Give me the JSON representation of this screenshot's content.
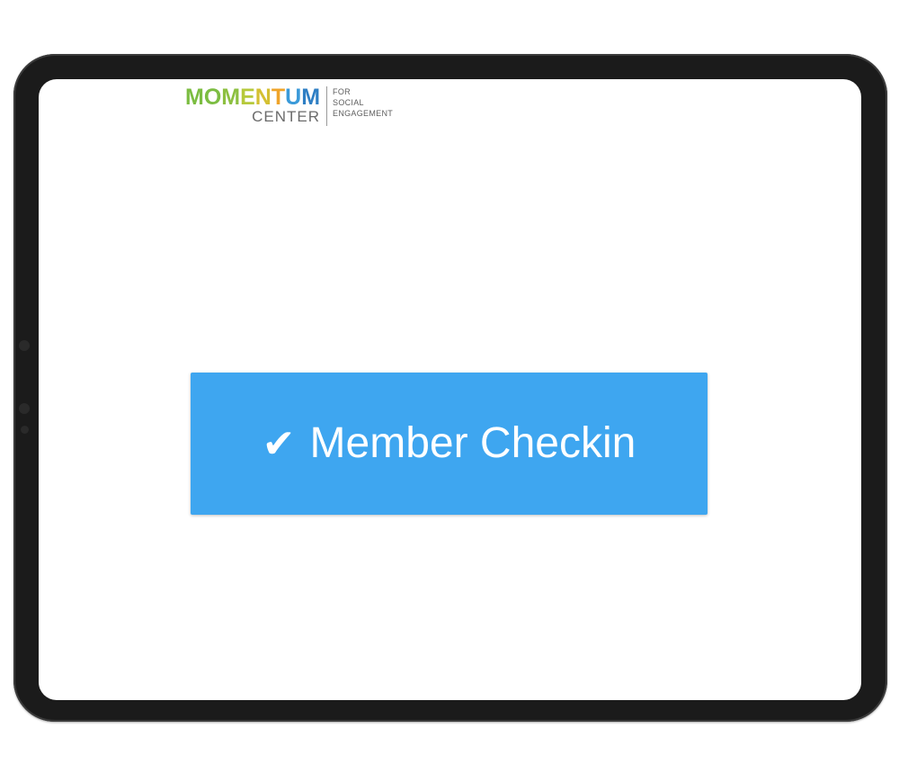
{
  "logo": {
    "letters": [
      {
        "ch": "M",
        "color": "#7cbd42"
      },
      {
        "ch": "O",
        "color": "#7cbd42"
      },
      {
        "ch": "M",
        "color": "#8dc041"
      },
      {
        "ch": "E",
        "color": "#b6c93b"
      },
      {
        "ch": "N",
        "color": "#d4c032"
      },
      {
        "ch": "T",
        "color": "#efa42a"
      },
      {
        "ch": "U",
        "color": "#3a9ad9"
      },
      {
        "ch": "M",
        "color": "#2f7fc4"
      }
    ],
    "subtitle": "CENTER",
    "tagline_line1": "FOR",
    "tagline_line2": "SOCIAL",
    "tagline_line3": "ENGAGEMENT"
  },
  "checkin": {
    "icon": "checkmark-icon",
    "glyph": "✔",
    "label": "Member Checkin",
    "color": "#3ea6f0"
  }
}
